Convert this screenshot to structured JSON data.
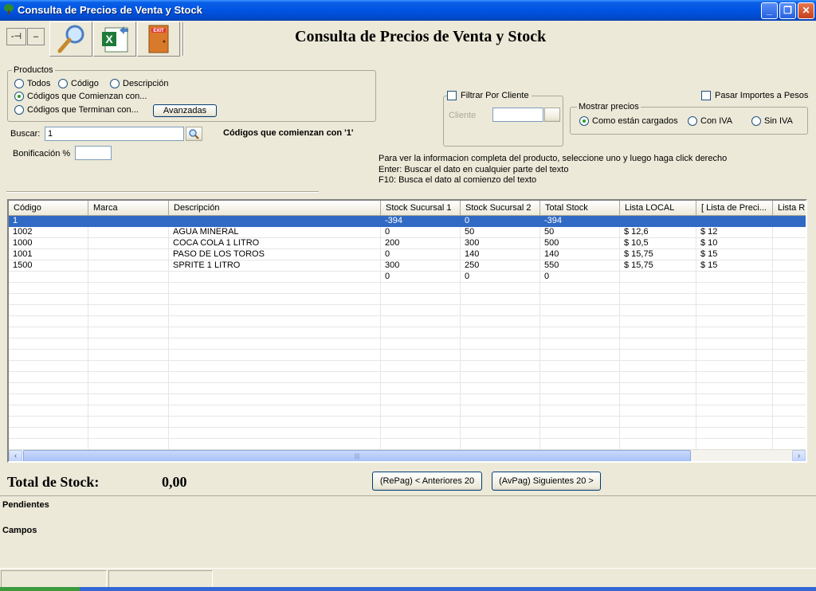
{
  "window": {
    "title": "Consulta de Precios de Venta y Stock",
    "colors": {
      "titlebar": "#0054e3",
      "selection": "#316ac5",
      "face": "#ece9d8"
    }
  },
  "toolbar": {
    "pin_label": "-⊣",
    "minus_label": "–",
    "search_icon": "magnifier-icon",
    "excel_icon": "excel-export-icon",
    "exit_icon": "exit-door-icon",
    "exit_text": "EXIT"
  },
  "header": {
    "title": "Consulta de Precios de Venta y Stock"
  },
  "productos": {
    "legend": "Productos",
    "todos": "Todos",
    "codigo": "Código",
    "descripcion": "Descripción",
    "comienzan": "Códigos que Comienzan con...",
    "terminan": "Códigos que Terminan con...",
    "avanzadas": "Avanzadas",
    "selected": "comienzan"
  },
  "buscar": {
    "label": "Buscar:",
    "value": "1",
    "result_text": "Códigos que comienzan con '1'"
  },
  "bonificacion": {
    "label": "Bonificación %",
    "value": ""
  },
  "filtro": {
    "label": "Filtrar Por Cliente",
    "cliente_label": "Cliente",
    "cliente_value": ""
  },
  "pasar_importes": "Pasar Importes a Pesos",
  "mostrar": {
    "legend": "Mostrar precios",
    "como": "Como están cargados",
    "con_iva": "Con IVA",
    "sin_iva": "Sin IVA",
    "selected": "como"
  },
  "help": {
    "line1": "Para ver la informacion completa del producto, seleccione uno y luego haga click derecho",
    "line2": "Enter: Buscar el dato en cualquier parte del texto",
    "line3": "F10: Busca el dato al comienzo del texto"
  },
  "grid": {
    "columns": [
      "Código",
      "Marca",
      "Descripción",
      "Stock Sucursal 1",
      "Stock Sucursal 2",
      "Total Stock",
      "Lista LOCAL",
      "[ Lista de Preci...",
      "Lista R"
    ],
    "rows": [
      [
        "1",
        "",
        "",
        "-394",
        "0",
        "-394",
        "",
        "",
        ""
      ],
      [
        "1002",
        "",
        "AGUA MINERAL",
        "0",
        "50",
        "50",
        "$ 12,6",
        "$ 12",
        ""
      ],
      [
        "1000",
        "",
        "COCA COLA 1 LITRO",
        "200",
        "300",
        "500",
        "$ 10,5",
        "$ 10",
        ""
      ],
      [
        "1001",
        "",
        "PASO DE LOS TOROS",
        "0",
        "140",
        "140",
        "$ 15,75",
        "$ 15",
        ""
      ],
      [
        "1500",
        "",
        "SPRITE 1 LITRO",
        "300",
        "250",
        "550",
        "$ 15,75",
        "$ 15",
        ""
      ],
      [
        "",
        "",
        "",
        "0",
        "0",
        "0",
        "",
        "",
        ""
      ]
    ],
    "selected_row": 0,
    "scroll_left": "‹",
    "scroll_right": "›",
    "scroll_grip": "|||"
  },
  "totals": {
    "label": "Total de Stock:",
    "value": "0,00"
  },
  "pager": {
    "prev": "(RePag) < Anteriores 20",
    "next": "(AvPag) Siguientes 20 >"
  },
  "bottom": {
    "pendientes": "Pendientes",
    "campos": "Campos"
  }
}
